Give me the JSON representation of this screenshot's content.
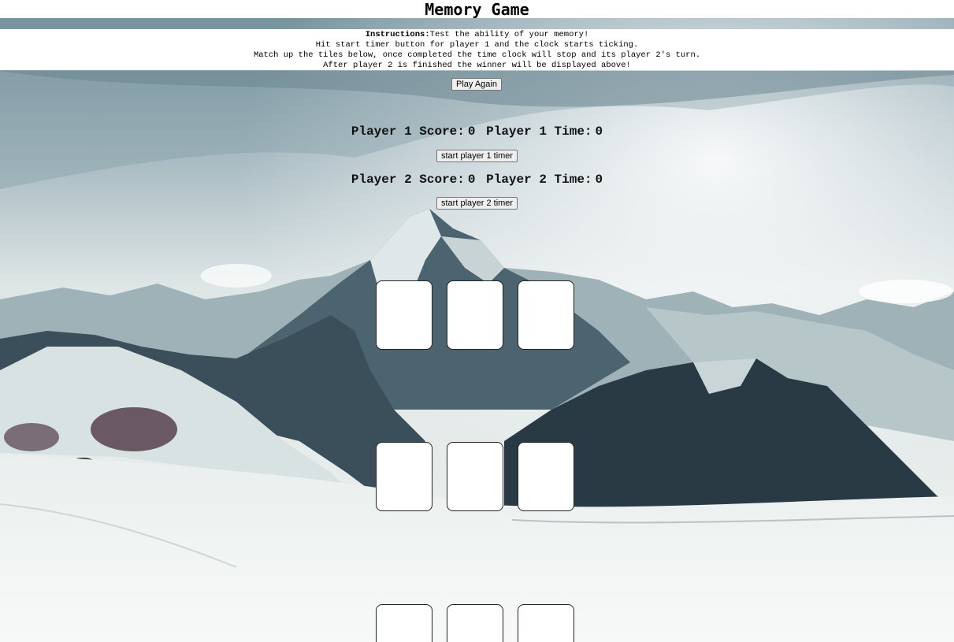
{
  "title": "Memory Game",
  "instructions": {
    "label": "Instructions:",
    "line1": "Test the ability of your memory!",
    "line2": "Hit start timer button for player 1 and the clock starts ticking.",
    "line3": "Match up the tiles below, once completed the time clock will stop and its player 2's turn.",
    "line4": "After player 2 is finished the winner will be displayed above!"
  },
  "play_again_label": "Play Again",
  "player1": {
    "score_label": "Player 1 Score:",
    "score": "0",
    "time_label": "Player 1 Time:",
    "time": "0",
    "timer_button": "start player 1 timer"
  },
  "player2": {
    "score_label": "Player 2 Score:",
    "score": "0",
    "time_label": "Player 2 Time:",
    "time": "0",
    "timer_button": "start player 2 timer"
  },
  "tiles": [
    "",
    "",
    "",
    "",
    "",
    "",
    "",
    "",
    ""
  ]
}
